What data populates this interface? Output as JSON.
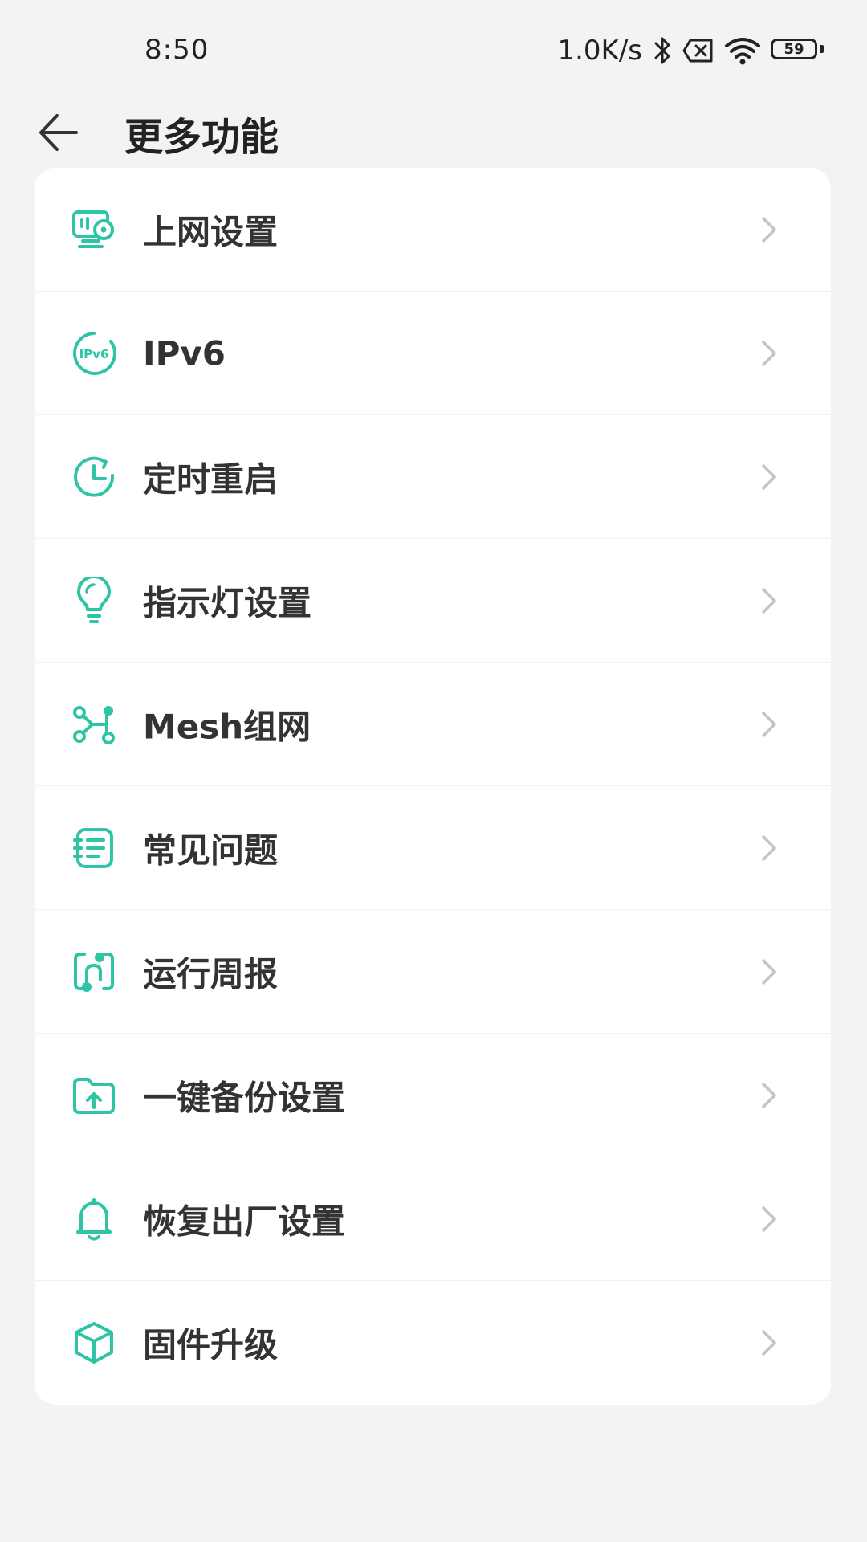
{
  "status_bar": {
    "time": "8:50",
    "net_speed": "1.0K/s",
    "battery": "59",
    "icons": [
      "bluetooth-icon",
      "sim-off-icon",
      "wifi-icon",
      "battery-icon"
    ]
  },
  "header": {
    "title": "更多功能",
    "back_icon": "back-arrow-icon"
  },
  "menu": {
    "accent_color": "#2ec4a5",
    "items": [
      {
        "label": "上网设置",
        "icon": "network-settings-icon"
      },
      {
        "label": "IPv6",
        "icon": "ipv6-icon"
      },
      {
        "label": "定时重启",
        "icon": "timer-restart-icon"
      },
      {
        "label": "指示灯设置",
        "icon": "indicator-light-icon"
      },
      {
        "label": "Mesh组网",
        "icon": "mesh-network-icon"
      },
      {
        "label": "常见问题",
        "icon": "faq-icon"
      },
      {
        "label": "运行周报",
        "icon": "weekly-report-icon"
      },
      {
        "label": "一键备份设置",
        "icon": "backup-icon"
      },
      {
        "label": "恢复出厂设置",
        "icon": "factory-reset-icon"
      },
      {
        "label": "固件升级",
        "icon": "firmware-upgrade-icon"
      }
    ]
  }
}
